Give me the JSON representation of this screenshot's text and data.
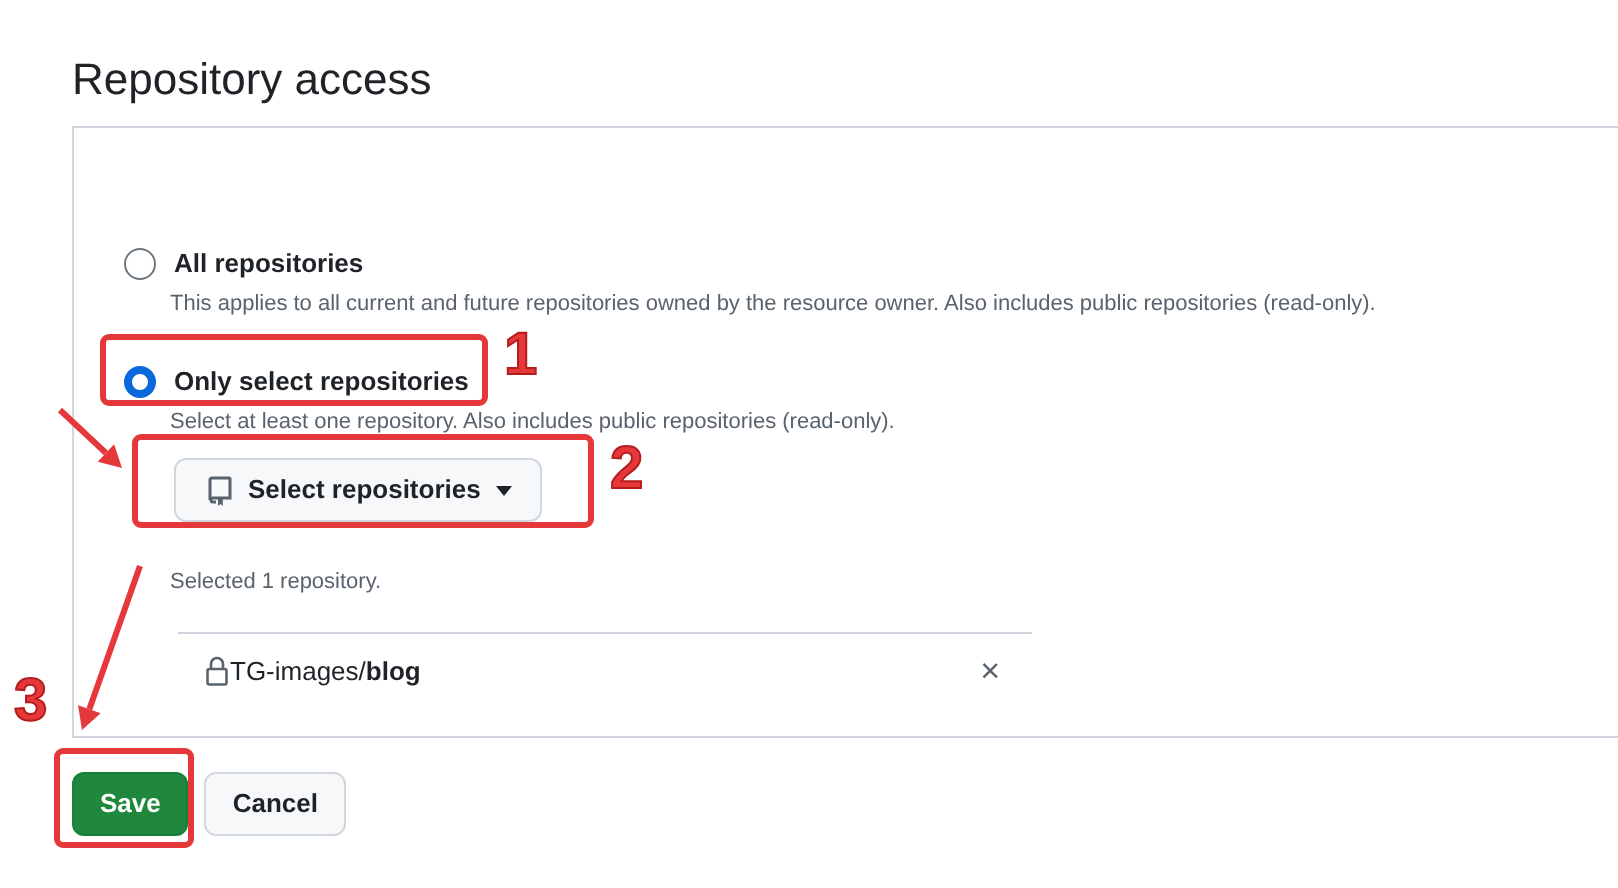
{
  "heading": "Repository access",
  "options": [
    {
      "label": "All repositories",
      "description": "This applies to all current and future repositories owned by the resource owner. Also includes public repositories (read-only).",
      "selected": false
    },
    {
      "label": "Only select repositories",
      "description": "Select at least one repository. Also includes public repositories (read-only).",
      "selected": true
    }
  ],
  "select_button": {
    "label": "Select repositories"
  },
  "selection_summary": "Selected 1 repository.",
  "selected_repositories": [
    {
      "name": "TG-images/**blog**",
      "remove": "×"
    }
  ],
  "buttons": [
    {
      "label": "Save",
      "kind": "primary"
    },
    {
      "label": "Cancel",
      "kind": "secondary"
    }
  ],
  "annotations": [
    {
      "number": "1"
    },
    {
      "number": "2"
    },
    {
      "number": "3"
    }
  ]
}
